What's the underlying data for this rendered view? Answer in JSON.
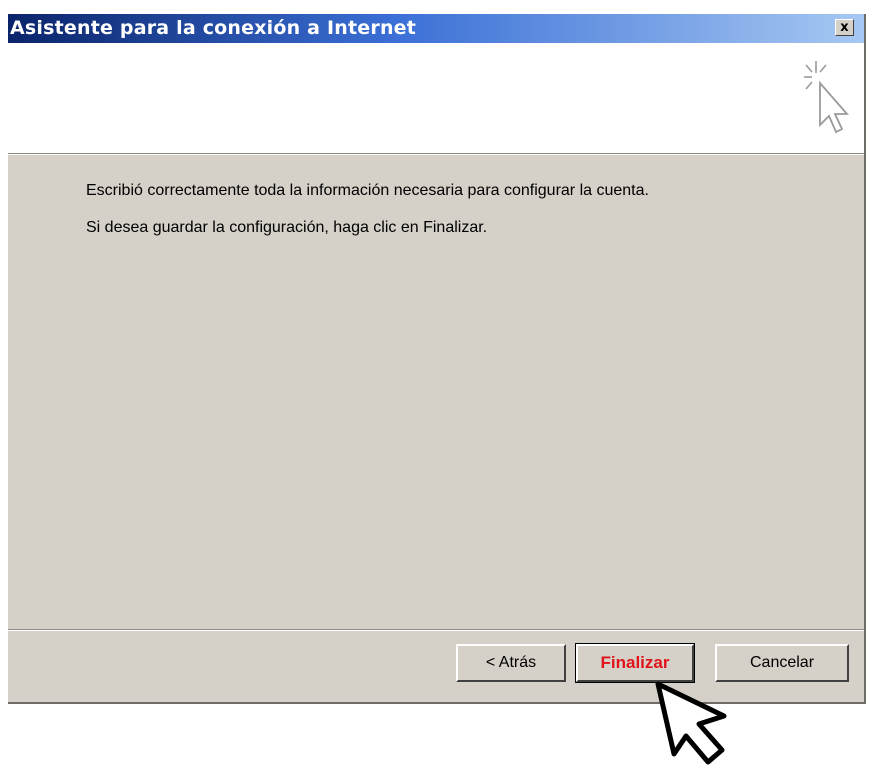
{
  "window": {
    "title": "Asistente para la conexión a Internet",
    "close_label": "x"
  },
  "header": {
    "icon": "wizard-cursor-sparkle-icon"
  },
  "body": {
    "message_1": "Escribió correctamente toda la información necesaria para configurar la cuenta.",
    "message_2": "Si desea guardar la configuración, haga clic en Finalizar."
  },
  "buttons": {
    "back_label": "< Atrás",
    "finish_label": "Finalizar",
    "cancel_label": "Cancelar"
  },
  "overlay": {
    "pointer_icon": "mouse-pointer-icon"
  },
  "colors": {
    "titlebar_start": "#0a246a",
    "titlebar_end": "#a6c8f2",
    "dialog_face": "#d5d0c8",
    "finish_text": "#e0141a"
  }
}
